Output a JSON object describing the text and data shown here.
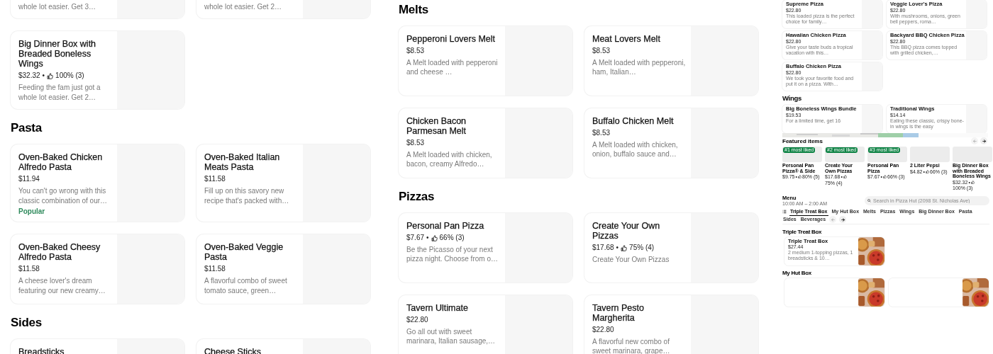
{
  "panels": [
    {
      "blocks": [
        {
          "kind": "section",
          "items": [
            {
              "kind": "partial",
              "description": "whole lot easier. Get 3…"
            },
            {
              "kind": "partial",
              "description": "whole lot easier. Get 2…"
            },
            {
              "name": "Big Dinner Box with Breaded Boneless Wings",
              "price": "$32.32",
              "separator": "•",
              "rating": "100% (3)",
              "description": "Feeding the fam just got a whole lot easier. Get 2…"
            }
          ]
        },
        {
          "kind": "section",
          "title": "Pasta",
          "items": [
            {
              "name": "Oven-Baked Chicken Alfredo Pasta",
              "price": "$11.94",
              "description": "You can't go wrong with this classic combination of our…",
              "tag": "Popular"
            },
            {
              "name": "Oven-Baked Italian Meats Pasta",
              "price": "$11.58",
              "description": "Fill up on this savory new recipe that's packed with…"
            },
            {
              "name": "Oven-Baked Cheesy Alfredo Pasta",
              "price": "$11.58",
              "description": "A cheese lover's dream featuring our new creamy…"
            },
            {
              "name": "Oven-Baked Veggie Pasta",
              "price": "$11.58",
              "description": "A flavorful combo of sweet tomato sauce, green…"
            }
          ]
        },
        {
          "kind": "section",
          "title": "Sides",
          "items": [
            {
              "name": "Breadsticks"
            },
            {
              "name": "Cheese Sticks"
            }
          ]
        }
      ]
    },
    {
      "blocks": [
        {
          "kind": "section",
          "title": "Melts",
          "items": [
            {
              "name": "Pepperoni Lovers Melt",
              "price": "$8.53",
              "description": "A Melt loaded with pepperoni and cheese …"
            },
            {
              "name": "Meat Lovers Melt",
              "price": "$8.53",
              "description": "A Melt loaded with pepperoni, ham, Italian…"
            },
            {
              "name": "Chicken Bacon Parmesan Melt",
              "price": "$8.53",
              "description": "A Melt loaded with chicken, bacon, creamy Alfredo…"
            },
            {
              "name": "Buffalo Chicken Melt",
              "price": "$8.53",
              "description": "A Melt loaded with chicken, onion, buffalo sauce and…"
            }
          ]
        },
        {
          "kind": "section",
          "title": "Pizzas",
          "items": [
            {
              "name": "Personal Pan Pizza",
              "price": "$7.67",
              "separator": "•",
              "rating": "66% (3)",
              "description": "Be the Picasso of your next pizza night. Choose from o…"
            },
            {
              "name": "Create Your Own Pizzas",
              "price": "$17.68",
              "separator": "•",
              "rating": "75% (4)",
              "description": "Create Your Own Pizzas"
            },
            {
              "name": "Tavern Ultimate",
              "price": "$22.80",
              "description": "Go all out with sweet marinara, Italian sausage,…"
            },
            {
              "name": "Tavern Pesto Margherita",
              "price": "$22.80",
              "description": "A flavorful new combo of sweet marinara, grape…"
            }
          ]
        }
      ]
    },
    {
      "blocks": [
        {
          "kind": "section",
          "items": [
            {
              "name": "Supreme Pizza",
              "price": "$22.80",
              "description": "This loaded pizza is the perfect choice for family…"
            },
            {
              "name": "Veggie Lover's Pizza",
              "price": "$22.80",
              "description": "With mushrooms, onions, green bell peppers, roma…"
            },
            {
              "name": "Hawaiian Chicken Pizza",
              "price": "$22.80",
              "description": "Give your taste buds a tropical vacation with this…"
            },
            {
              "name": "Backyard BBQ Chicken Pizza",
              "price": "$22.80",
              "description": "This BBQ pizza comes topped with grilled chicken,…"
            },
            {
              "name": "Buffalo Chicken Pizza",
              "price": "$22.80",
              "description": "We took your favorite food and put it on a pizza. With…"
            }
          ]
        },
        {
          "kind": "section",
          "title": "Wings",
          "items": [
            {
              "name": "Big Boneless Wings Bundle",
              "price": "$19.53",
              "description": "For a limited time, get 16"
            },
            {
              "name": "Traditional Wings",
              "price": "$14.14",
              "description": "Eating these classic, crispy bone-in wings is the easy"
            }
          ]
        },
        {
          "kind": "map"
        },
        {
          "kind": "featured",
          "title": "Featured items",
          "items": [
            {
              "badge": "#1 most liked",
              "name": "Personal Pan Pizza® & Side",
              "price": "$9.75",
              "separator": "•",
              "rating": "80% (5)"
            },
            {
              "badge": "#2 most liked",
              "name": "Create Your Own Pizzas",
              "price": "$17.68",
              "separator": "•",
              "rating": "75% (4)"
            },
            {
              "badge": "#3 most liked",
              "name": "Personal Pan Pizza",
              "price": "$7.67",
              "separator": "•",
              "rating": "66% (3)"
            },
            {
              "name": "2 Liter Pepsi",
              "price": "$4.82",
              "separator": "•",
              "rating": "66% (3)"
            },
            {
              "name": "Big Dinner Box with Breaded Boneless Wings",
              "price": "$32.32",
              "separator": "•",
              "rating": "100% (3)"
            }
          ]
        },
        {
          "kind": "menu",
          "title": "Menu",
          "hours": "10:00 AM – 2:00 AM",
          "search": {
            "placeholder": "Search in Pizza Hut (2098 St. Nicholas Ave)"
          },
          "tabs": [
            {
              "label": "Triple Treat Box",
              "selected": true
            },
            {
              "label": "My Hut Box",
              "selected": false
            },
            {
              "label": "Melts",
              "selected": false
            },
            {
              "label": "Pizzas",
              "selected": false
            },
            {
              "label": "Wings",
              "selected": false
            },
            {
              "label": "Big Dinner Box",
              "selected": false
            },
            {
              "label": "Pasta",
              "selected": false
            },
            {
              "label": "Sides",
              "selected": false
            },
            {
              "label": "Beverages",
              "selected": false
            }
          ]
        },
        {
          "kind": "list_section",
          "title": "Triple Treat Box",
          "items": [
            {
              "kind": "with_picture",
              "name": "Triple Treat Box",
              "price": "$27.44",
              "description": "2 medium 1-topping pizzas, 1 breadsticks & 10…"
            }
          ]
        },
        {
          "kind": "list_section",
          "title": "My Hut Box"
        }
      ]
    }
  ]
}
